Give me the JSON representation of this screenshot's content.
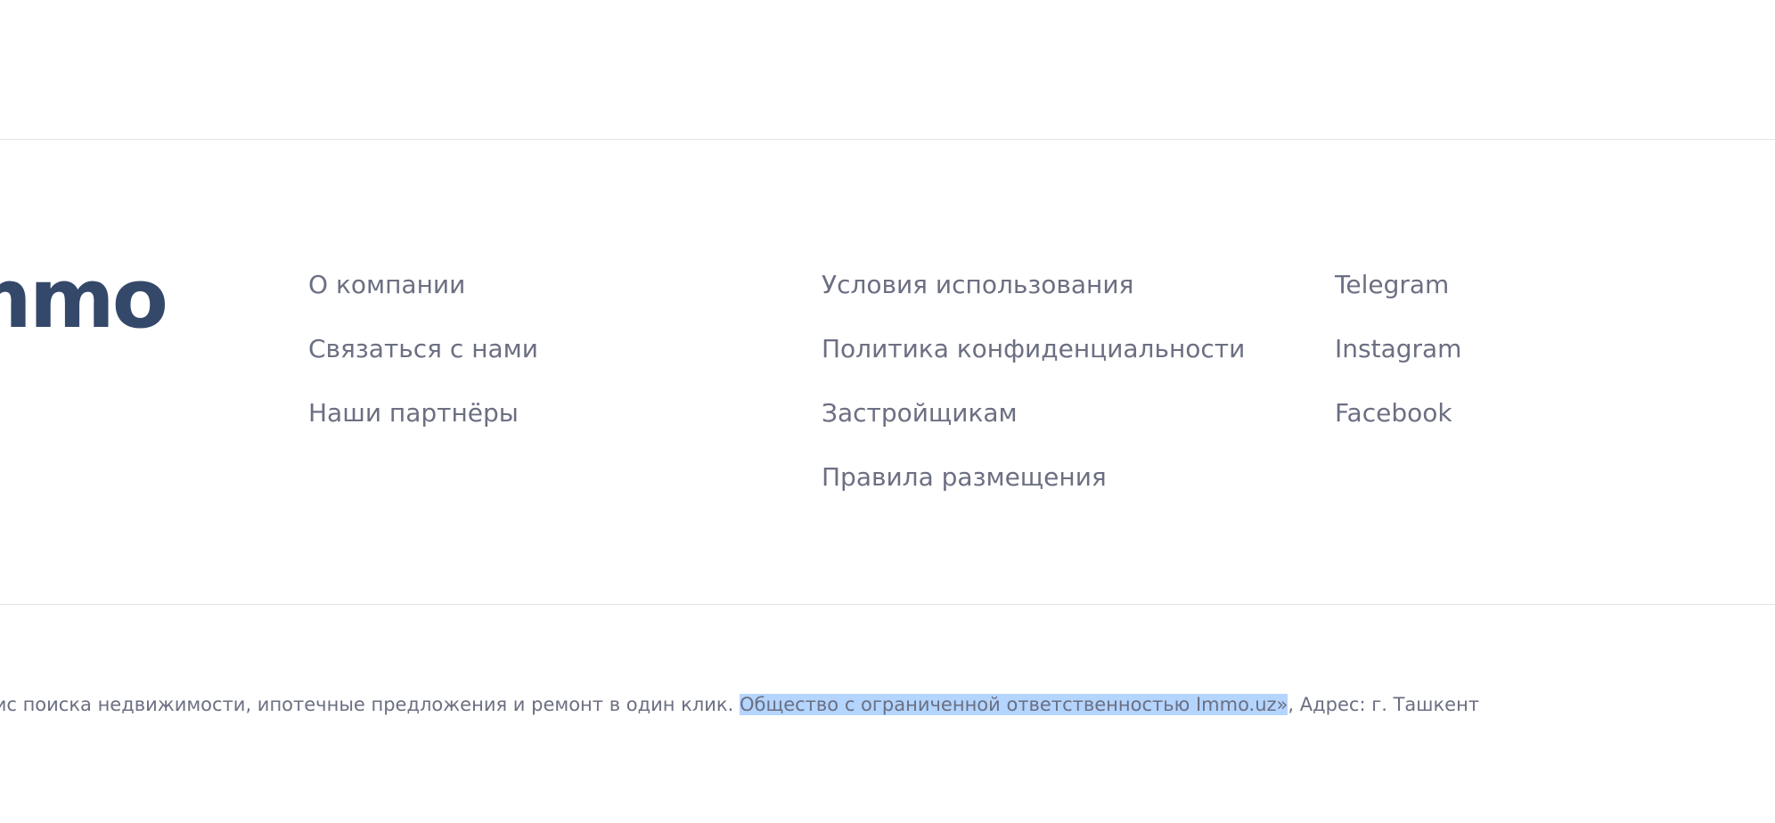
{
  "logo": {
    "text": "mmo"
  },
  "links": {
    "col1": [
      "О компании",
      "Связаться с нами",
      "Наши партнёры"
    ],
    "col2": [
      "Условия использования",
      "Политика конфиденциальности",
      "Застройщикам",
      "Правила размещения"
    ],
    "col3": [
      "Telegram",
      "Instagram",
      "Facebook"
    ]
  },
  "legal": {
    "before": "рвис поиска недвижимости, ипотечные предложения и ремонт в один клик. ",
    "highlighted": "Общество с ограниченной ответственностью Immo.uz»",
    "after": ", Адрес: г. Ташкент"
  },
  "colors": {
    "logo": "#34486a",
    "link": "#6b6f82",
    "selection": "#b4d5fe",
    "divider": "#e3e4e8"
  }
}
